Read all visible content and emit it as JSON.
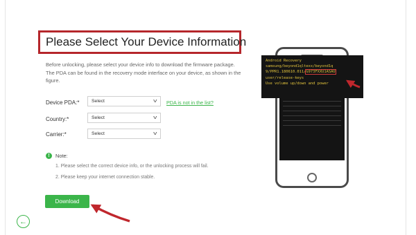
{
  "title": "Please Select Your Device Information",
  "description": "Before unlocking, please select your device info to download the firmware package. The PDA can be found in the recovery mode interface on your device, as shown in the figure.",
  "form": {
    "pda_label": "Device PDA:*",
    "pda_value": "Select",
    "pda_link": "PDA is not in the list?",
    "country_label": "Country:*",
    "country_value": "Select",
    "carrier_label": "Carrier:*",
    "carrier_value": "Select"
  },
  "note": {
    "icon": "!",
    "title": "Note:",
    "items": [
      "1. Please select the correct device info, or the unlocking process will fail.",
      "2. Please keep your internet connection stable."
    ]
  },
  "download_label": "Download",
  "back_icon": "←",
  "recovery": {
    "lines": [
      "Android Recovery",
      "samsung/beyond1qltexx/beyond1q",
      "9/PPR1.180610.011/",
      "G973FXXU1ASAU",
      "user/release-keys",
      "Use volume up/down and power"
    ]
  },
  "colors": {
    "accent": "#3bb54a",
    "highlight": "#b5262b",
    "recovery_text": "#e2c33c"
  }
}
